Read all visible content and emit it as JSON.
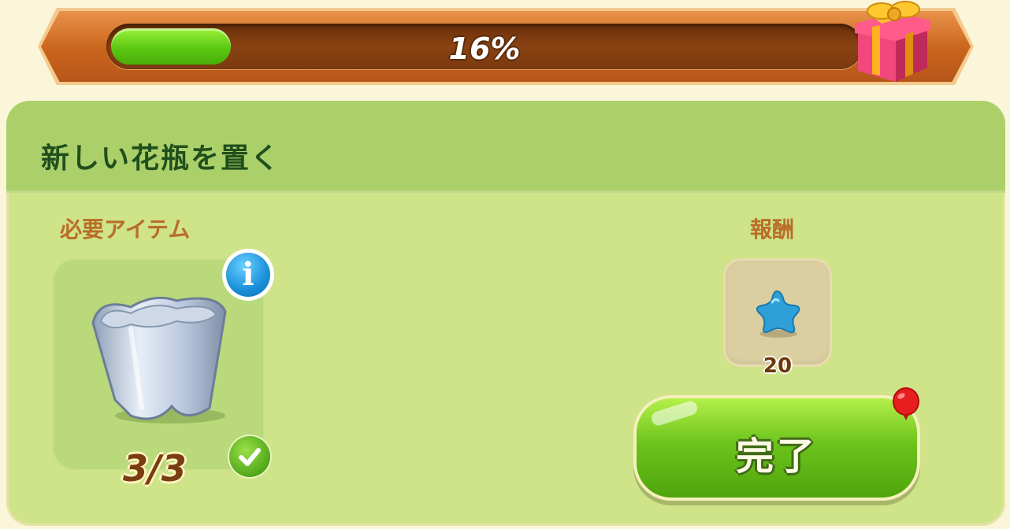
{
  "progress": {
    "percent_label": "16%",
    "fraction": 0.16
  },
  "task": {
    "title": "新しい花瓶を置く"
  },
  "required": {
    "label": "必要アイテム",
    "item_icon": "vase-icon",
    "count": "3/3"
  },
  "reward": {
    "label": "報酬",
    "icon": "blue-star-icon",
    "amount": "20"
  },
  "complete_button": {
    "label": "完了"
  },
  "colors": {
    "panel": "#cfe389",
    "header": "#abd06a",
    "button_green": "#6dc41c",
    "progress_fill": "#5cc812",
    "title": "#214f1c",
    "label": "#b86e28"
  }
}
